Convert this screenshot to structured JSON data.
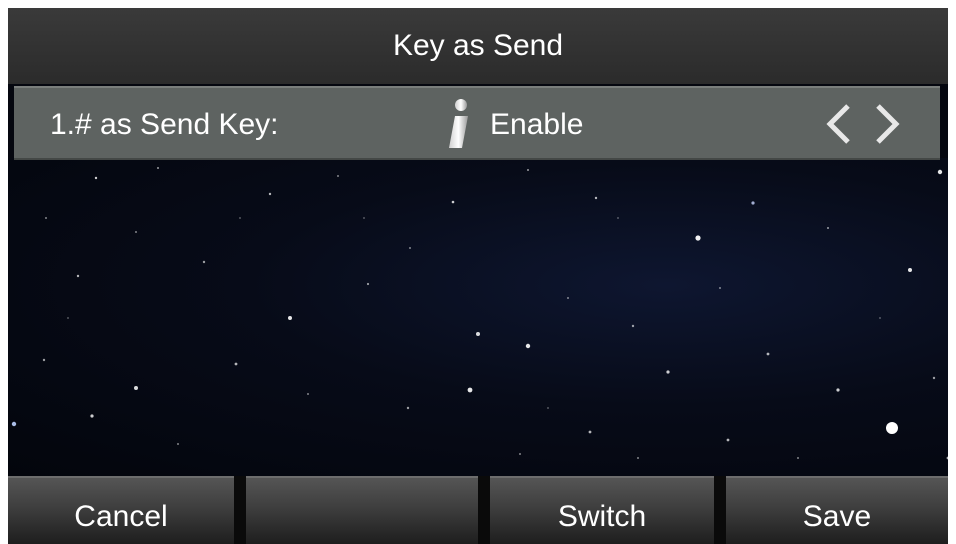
{
  "screen": {
    "title": "Key as Send"
  },
  "setting_row": {
    "label": "1.# as Send Key:",
    "info_icon": "info-icon",
    "value": "Enable",
    "prev_icon": "chevron-left-icon",
    "next_icon": "chevron-right-icon"
  },
  "softkeys": {
    "key1": "Cancel",
    "key2": "",
    "key3": "Switch",
    "key4": "Save"
  },
  "colors": {
    "title_bar": "#2b2b2b",
    "selected_row": "#5e6361",
    "softkey_bar": "#3e3e3e",
    "text": "#ffffff"
  }
}
